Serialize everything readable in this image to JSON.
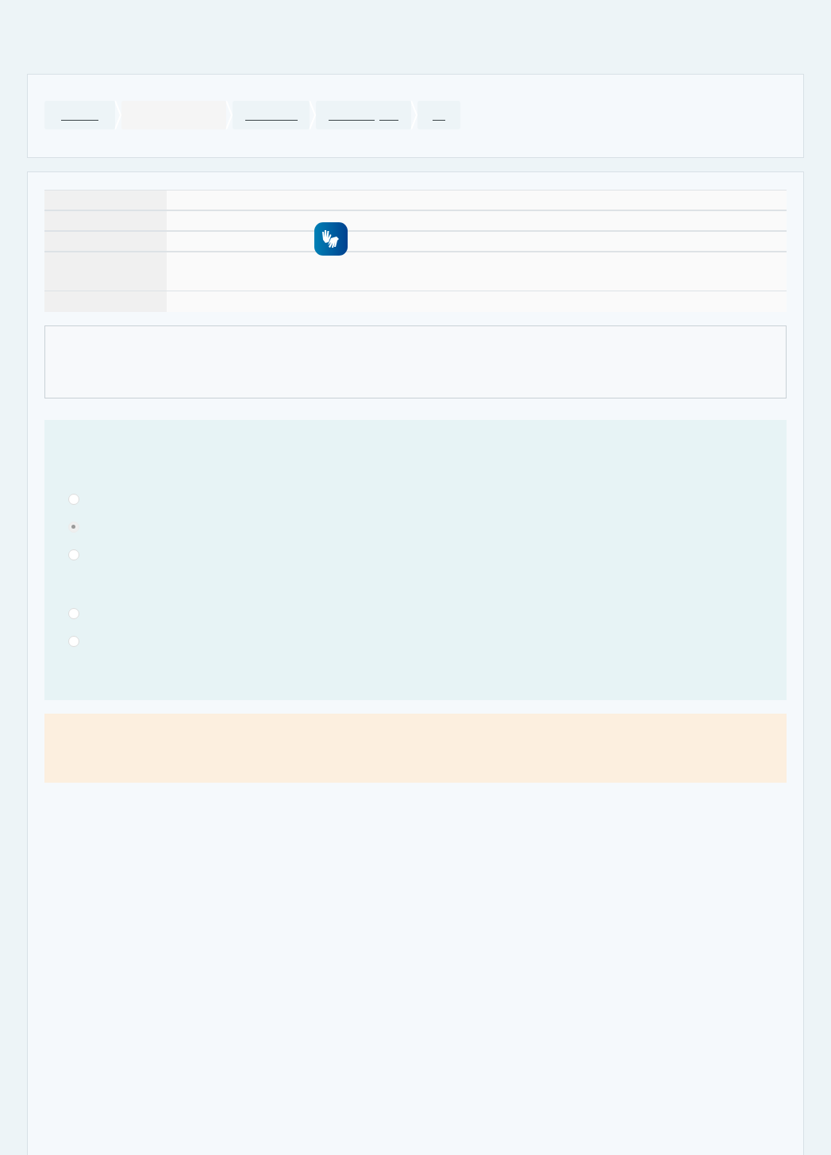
{
  "breadcrumb": [
    {
      "selected": false
    },
    {
      "selected": true
    },
    {
      "selected": false
    },
    {
      "selected": false
    },
    {
      "selected": false
    }
  ],
  "radio_options": [
    {
      "selected": false
    },
    {
      "selected": true
    },
    {
      "selected": false
    },
    {
      "selected": false
    },
    {
      "selected": false
    }
  ]
}
